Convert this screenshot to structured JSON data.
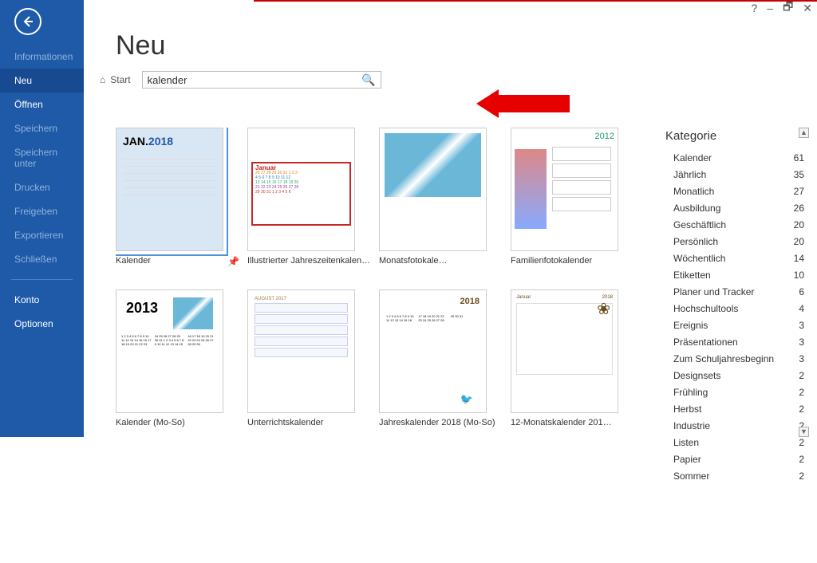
{
  "window_controls": {
    "help": "?",
    "min": "–",
    "restore": "🗗",
    "close": "✕"
  },
  "sidebar": {
    "items": [
      {
        "label": "Informationen",
        "active": false,
        "bright": false
      },
      {
        "label": "Neu",
        "active": true,
        "bright": true
      },
      {
        "label": "Öffnen",
        "active": false,
        "bright": true
      },
      {
        "label": "Speichern",
        "active": false,
        "bright": false
      },
      {
        "label": "Speichern unter",
        "active": false,
        "bright": false
      },
      {
        "label": "Drucken",
        "active": false,
        "bright": false
      },
      {
        "label": "Freigeben",
        "active": false,
        "bright": false
      },
      {
        "label": "Exportieren",
        "active": false,
        "bright": false
      },
      {
        "label": "Schließen",
        "active": false,
        "bright": false
      }
    ],
    "footer": [
      {
        "label": "Konto"
      },
      {
        "label": "Optionen"
      }
    ]
  },
  "page_title": "Neu",
  "search": {
    "start_label": "Start",
    "value": "kalender"
  },
  "templates": [
    {
      "label": "Kalender",
      "selected": true,
      "pin": "📌"
    },
    {
      "label": "Illustrierter Jahreszeitenkalender…"
    },
    {
      "label": "Monatsfotokale…"
    },
    {
      "label": "Familienfotokalender"
    },
    {
      "label": "Kalender (Mo-So)"
    },
    {
      "label": "Unterrichtskalender"
    },
    {
      "label": "Jahreskalender 2018 (Mo-So)"
    },
    {
      "label": "12-Monatskalender 201…"
    }
  ],
  "thumb_text": {
    "jan2018_a": "JAN.",
    "jan2018_b": "2018",
    "illus_jan": "Januar",
    "fam_year": "2012",
    "yr2013": "2013",
    "unt_mo": "AUGUST 2017",
    "jk18_yr": "2018",
    "mon12_mo": "Januar",
    "mon12_yr": "2018"
  },
  "category": {
    "heading": "Kategorie",
    "items": [
      {
        "name": "Kalender",
        "count": 61
      },
      {
        "name": "Jährlich",
        "count": 35
      },
      {
        "name": "Monatlich",
        "count": 27
      },
      {
        "name": "Ausbildung",
        "count": 26
      },
      {
        "name": "Geschäftlich",
        "count": 20
      },
      {
        "name": "Persönlich",
        "count": 20
      },
      {
        "name": "Wöchentlich",
        "count": 14
      },
      {
        "name": "Etiketten",
        "count": 10
      },
      {
        "name": "Planer und Tracker",
        "count": 6
      },
      {
        "name": "Hochschultools",
        "count": 4
      },
      {
        "name": "Ereignis",
        "count": 3
      },
      {
        "name": "Präsentationen",
        "count": 3
      },
      {
        "name": "Zum Schuljahresbeginn",
        "count": 3
      },
      {
        "name": "Designsets",
        "count": 2
      },
      {
        "name": "Frühling",
        "count": 2
      },
      {
        "name": "Herbst",
        "count": 2
      },
      {
        "name": "Industrie",
        "count": 2
      },
      {
        "name": "Listen",
        "count": 2
      },
      {
        "name": "Papier",
        "count": 2
      },
      {
        "name": "Sommer",
        "count": 2
      }
    ]
  }
}
